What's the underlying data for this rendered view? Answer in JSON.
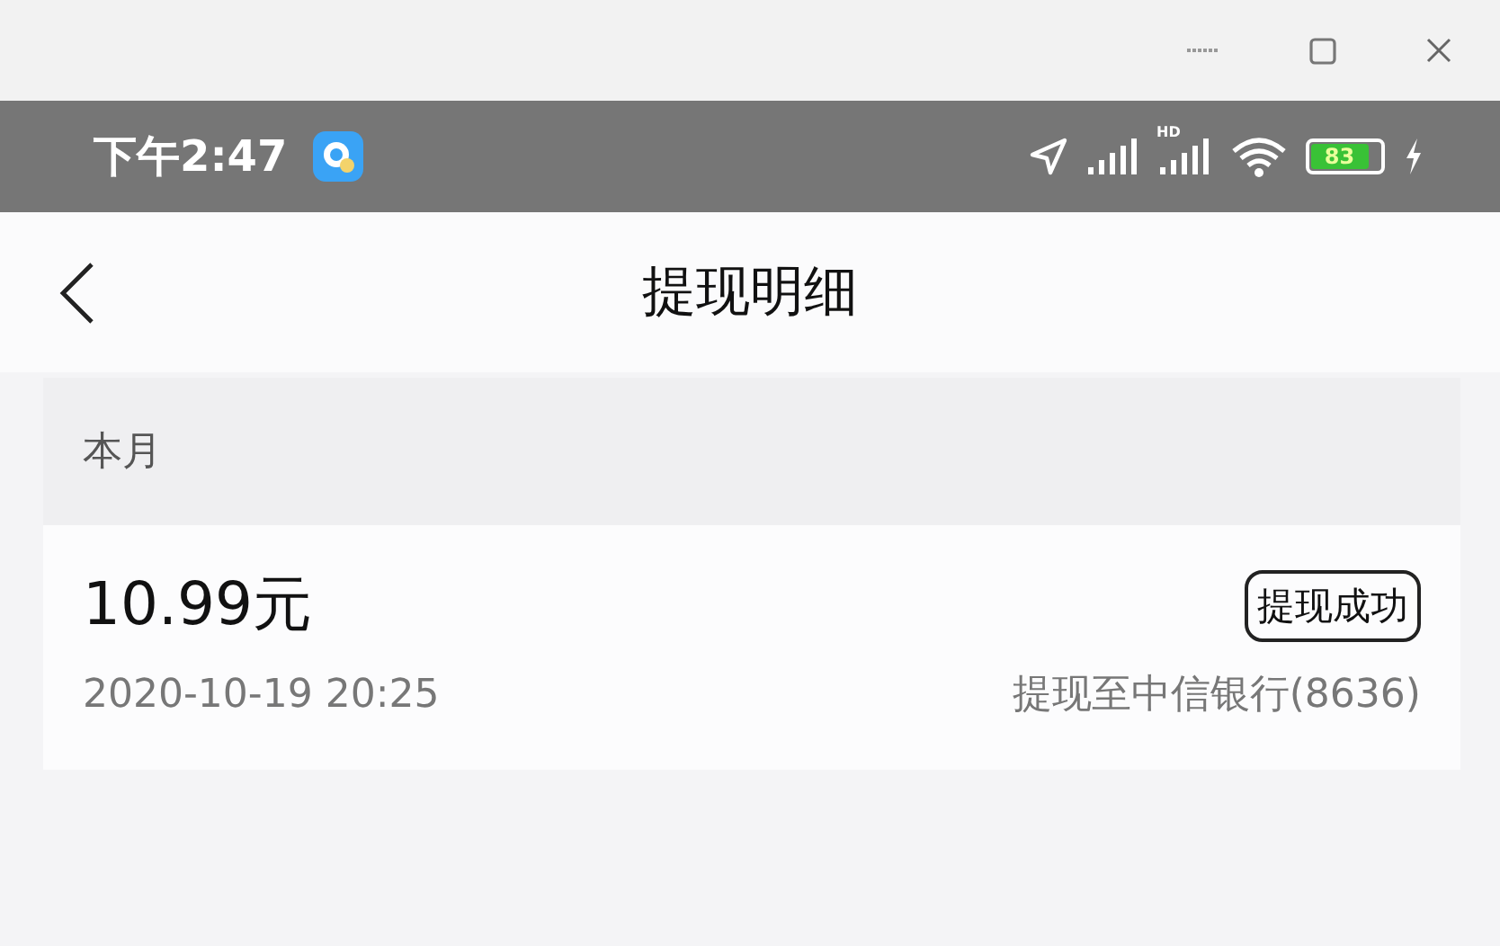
{
  "window": {
    "controls": [
      {
        "kind": "minimize"
      },
      {
        "kind": "maximize"
      },
      {
        "kind": "close"
      }
    ]
  },
  "status_bar": {
    "time": "下午2:47",
    "signal_label": "HD",
    "battery": "83",
    "charging": true
  },
  "header": {
    "title": "提现明细"
  },
  "sections": [
    {
      "label": "本月",
      "records": [
        {
          "amount": "10.99元",
          "status": "提现成功",
          "datetime": "2020-10-19 20:25",
          "destination": "提现至中信银行(8636)"
        }
      ]
    }
  ]
}
